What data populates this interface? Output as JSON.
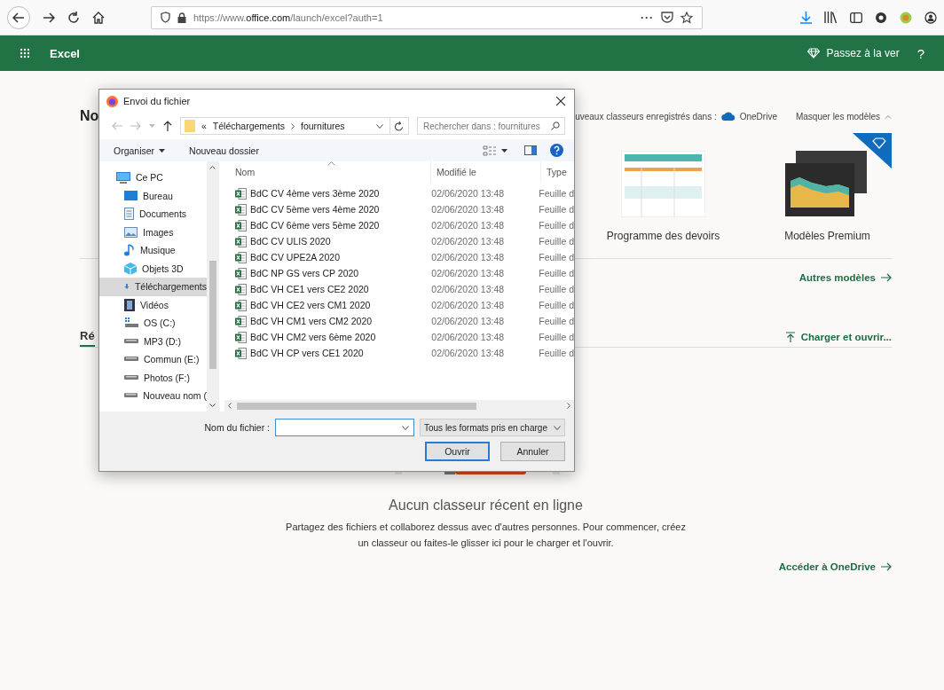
{
  "browser": {
    "url": "https://www.**office.com**/launch/excel?auth=1",
    "page_actions": "···"
  },
  "app_bar": {
    "title": "Excel",
    "upgrade": "Passez à la ver",
    "help": "?"
  },
  "new_section": {
    "heading": "No",
    "save_location_label": "uveaux classeurs enregistrés dans :",
    "save_location": "OneDrive",
    "hide_templates": "Masquer les modèles",
    "templates": [
      {
        "label": "Programme des devoirs",
        "kind": "homework"
      },
      {
        "label": "Modèles Premium",
        "kind": "premium"
      }
    ],
    "more_templates": "Autres modèles"
  },
  "recent": {
    "tab": "Ré",
    "upload": "Charger et ouvrir...",
    "empty_title": "Aucun classeur récent en ligne",
    "empty_text": "Partagez des fichiers et collaborez dessus avec d'autres personnes. Pour commencer, créez un classeur ou faites-le glisser ici pour le charger et l'ouvrir.",
    "onedrive_link": "Accéder à OneDrive"
  },
  "dialog": {
    "title": "Envoi du fichier",
    "breadcrumb_overflow": "«",
    "path": [
      "Téléchargements",
      "fournitures"
    ],
    "search": {
      "placeholder": "Rechercher dans : fournitures"
    },
    "toolbar": {
      "organize": "Organiser",
      "new_folder": "Nouveau dossier"
    },
    "nav": [
      {
        "label": "Ce PC",
        "kind": "pc",
        "selected": false,
        "children": [
          {
            "label": "Bureau",
            "kind": "desktop",
            "selected": false
          },
          {
            "label": "Documents",
            "kind": "documents",
            "selected": false
          },
          {
            "label": "Images",
            "kind": "images",
            "selected": false
          },
          {
            "label": "Musique",
            "kind": "music",
            "selected": false
          },
          {
            "label": "Objets 3D",
            "kind": "objects",
            "selected": false
          },
          {
            "label": "Téléchargements",
            "kind": "downloads",
            "selected": true
          },
          {
            "label": "Vidéos",
            "kind": "videos",
            "selected": false
          },
          {
            "label": "OS (C:)",
            "kind": "system-drive",
            "selected": false
          },
          {
            "label": "MP3 (D:)",
            "kind": "drive",
            "selected": false
          },
          {
            "label": "Commun (E:)",
            "kind": "drive",
            "selected": false
          },
          {
            "label": "Photos (F:)",
            "kind": "drive",
            "selected": false
          },
          {
            "label": "Nouveau nom (",
            "kind": "drive",
            "selected": false
          }
        ]
      }
    ],
    "columns": [
      "Nom",
      "Modifié le",
      "Type"
    ],
    "files": [
      {
        "name": "BdC CV 4ème vers 3ème 2020",
        "modified": "02/06/2020 13:48",
        "type": "Feuille d"
      },
      {
        "name": "BdC CV 5ème vers 4ème 2020",
        "modified": "02/06/2020 13:48",
        "type": "Feuille d"
      },
      {
        "name": "BdC CV 6ème vers 5ème 2020",
        "modified": "02/06/2020 13:48",
        "type": "Feuille d"
      },
      {
        "name": "BdC CV ULIS 2020",
        "modified": "02/06/2020 13:48",
        "type": "Feuille d"
      },
      {
        "name": "BdC CV UPE2A 2020",
        "modified": "02/06/2020 13:48",
        "type": "Feuille d"
      },
      {
        "name": "BdC NP GS vers CP 2020",
        "modified": "02/06/2020 13:48",
        "type": "Feuille d"
      },
      {
        "name": "BdC VH CE1 vers CE2 2020",
        "modified": "02/06/2020 13:48",
        "type": "Feuille d"
      },
      {
        "name": "BdC VH CE2 vers CM1 2020",
        "modified": "02/06/2020 13:48",
        "type": "Feuille d"
      },
      {
        "name": "BdC VH CM1 vers CM2 2020",
        "modified": "02/06/2020 13:48",
        "type": "Feuille d"
      },
      {
        "name": "BdC VH CM2 vers 6ème 2020",
        "modified": "02/06/2020 13:48",
        "type": "Feuille d"
      },
      {
        "name": "BdC VH CP vers CE1 2020",
        "modified": "02/06/2020 13:48",
        "type": "Feuille d"
      }
    ],
    "filename_label": "Nom du fichier :",
    "filter": "Tous les formats pris en charge",
    "buttons": [
      "Ouvrir",
      "Annuler"
    ]
  }
}
